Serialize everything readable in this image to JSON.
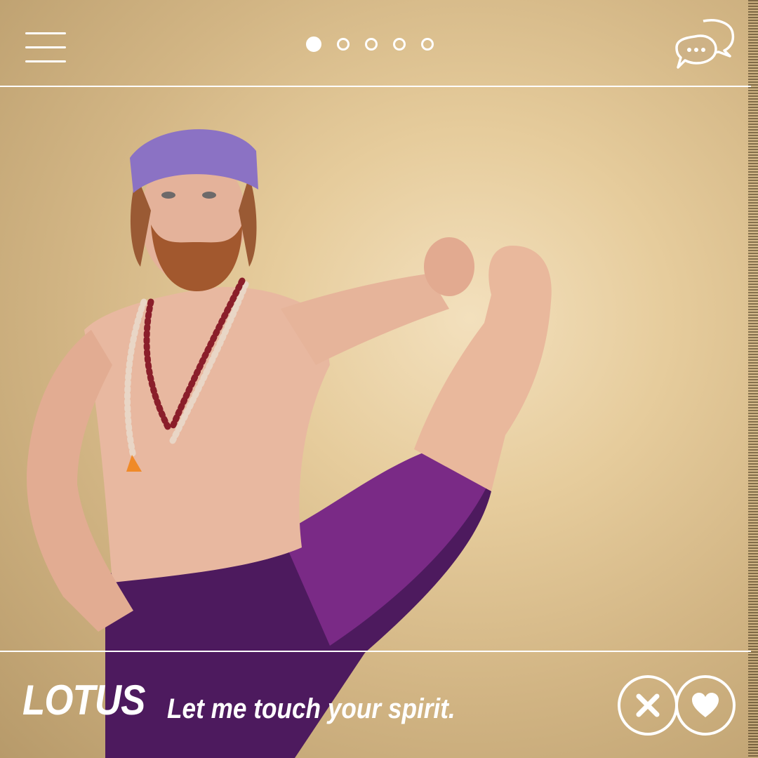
{
  "header": {
    "menu_icon": "hamburger-menu-icon",
    "page_indicator": {
      "count": 5,
      "active_index": 0
    },
    "chat_icon": "chat-bubbles-icon"
  },
  "profile": {
    "name": "LOTUS",
    "tagline": "Let me touch your spirit."
  },
  "actions": {
    "dislike_icon": "close-x-icon",
    "like_icon": "heart-icon"
  },
  "colors": {
    "ui_white": "#ffffff",
    "background_tan": "#e6cc9c",
    "headband_purple": "#8b72c4",
    "pants_purple": "#5e1f6e"
  }
}
